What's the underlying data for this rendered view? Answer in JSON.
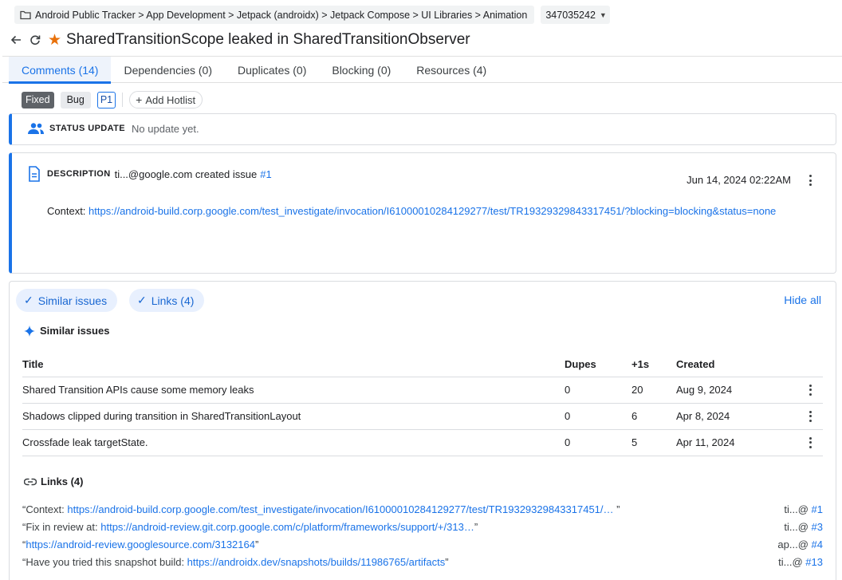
{
  "breadcrumb": {
    "icon": "folder-icon",
    "text": "Android Public Tracker > App Development > Jetpack (androidx) > Jetpack Compose > UI Libraries > Animation"
  },
  "issue": {
    "id": "347035242",
    "title": "SharedTransitionScope leaked in SharedTransitionObserver"
  },
  "tabs": [
    {
      "label": "Comments (14)"
    },
    {
      "label": "Dependencies (0)"
    },
    {
      "label": "Duplicates (0)"
    },
    {
      "label": "Blocking (0)"
    },
    {
      "label": "Resources (4)"
    }
  ],
  "chips": {
    "status": "Fixed",
    "type": "Bug",
    "priority": "P1",
    "add_hotlist": "Add Hotlist"
  },
  "status_update": {
    "label": "STATUS UPDATE",
    "text": "No update yet."
  },
  "description": {
    "label": "DESCRIPTION",
    "author_text": "ti...@google.com created issue",
    "issue_ref": "#1",
    "date": "Jun 14, 2024 02:22AM",
    "context_label": "Context:",
    "context_link": "https://android-build.corp.google.com/test_investigate/invocation/I61000010284129277/test/TR19329329843317451/?blocking=blocking&status=none"
  },
  "related": {
    "pill_similar": "Similar issues",
    "pill_links": "Links (4)",
    "hide_all": "Hide all",
    "similar_title": "Similar issues",
    "columns": {
      "title": "Title",
      "dupes": "Dupes",
      "plus": "+1s",
      "created": "Created"
    },
    "rows": [
      {
        "title": "Shared Transition APIs cause some memory leaks",
        "dupes": "0",
        "plus": "20",
        "created": "Aug 9, 2024"
      },
      {
        "title": "Shadows clipped during transition in SharedTransitionLayout",
        "dupes": "0",
        "plus": "6",
        "created": "Apr 8, 2024"
      },
      {
        "title": "Crossfade leak targetState.",
        "dupes": "0",
        "plus": "5",
        "created": "Apr 11, 2024"
      }
    ],
    "links_title": "Links (4)",
    "links": [
      {
        "prefix": "“Context: ",
        "url": "https://android-build.corp.google.com/test_investigate/invocation/I61000010284129277/test/TR19329329843317451/…",
        "suffix": " ”",
        "who": "ti...@",
        "ref": "#1"
      },
      {
        "prefix": "“Fix in review at: ",
        "url": "https://android-review.git.corp.google.com/c/platform/frameworks/support/+/313…",
        "suffix": "”",
        "who": "ti...@",
        "ref": "#3"
      },
      {
        "prefix": "“",
        "url": "https://android-review.googlesource.com/3132164",
        "suffix": "”",
        "who": "ap...@",
        "ref": "#4"
      },
      {
        "prefix": "“Have you tried this snapshot build: ",
        "url": "https://androidx.dev/snapshots/builds/11986765/artifacts",
        "suffix": "”",
        "who": "ti...@",
        "ref": "#13"
      }
    ]
  },
  "colors": {
    "accent": "#1a73e8",
    "star": "#e8710a",
    "chip_fixed": "#5f6368"
  }
}
